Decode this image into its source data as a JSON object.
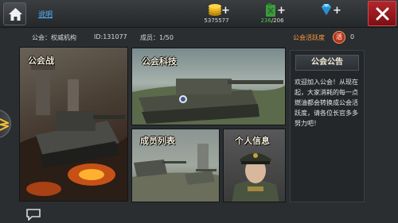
{
  "topbar": {
    "help_label": "说明",
    "gold": "5375577",
    "fuel_current": "236",
    "fuel_max": "/206",
    "plus": "+"
  },
  "guild": {
    "name": "公会：权威机构",
    "id": "ID:131077",
    "members": "成员：1/50",
    "activity_label": "公会活跃度",
    "activity_badge": "活",
    "activity_value": "0"
  },
  "panels": {
    "guild_war": "公会战",
    "tech": "公会科技",
    "members": "成员列表",
    "personal": "个人信息"
  },
  "notice": {
    "title": "公会公告",
    "body": "欢迎加入公会！从现在起，大家消耗的每一点燃油都会转换成公会活跃度，请各位长官多多努力吧！"
  },
  "icons": {
    "home": "home-icon",
    "gold": "gold-coins-icon",
    "fuel": "fuel-can-icon",
    "diamond": "diamond-icon",
    "close": "close-icon",
    "side": "wings-icon",
    "chat": "chat-bubble-icon"
  },
  "colors": {
    "accent_orange": "#ff9a3c",
    "close_red": "#b3262a",
    "link_blue": "#58b4ff",
    "fuel_green": "#4cc24c"
  }
}
